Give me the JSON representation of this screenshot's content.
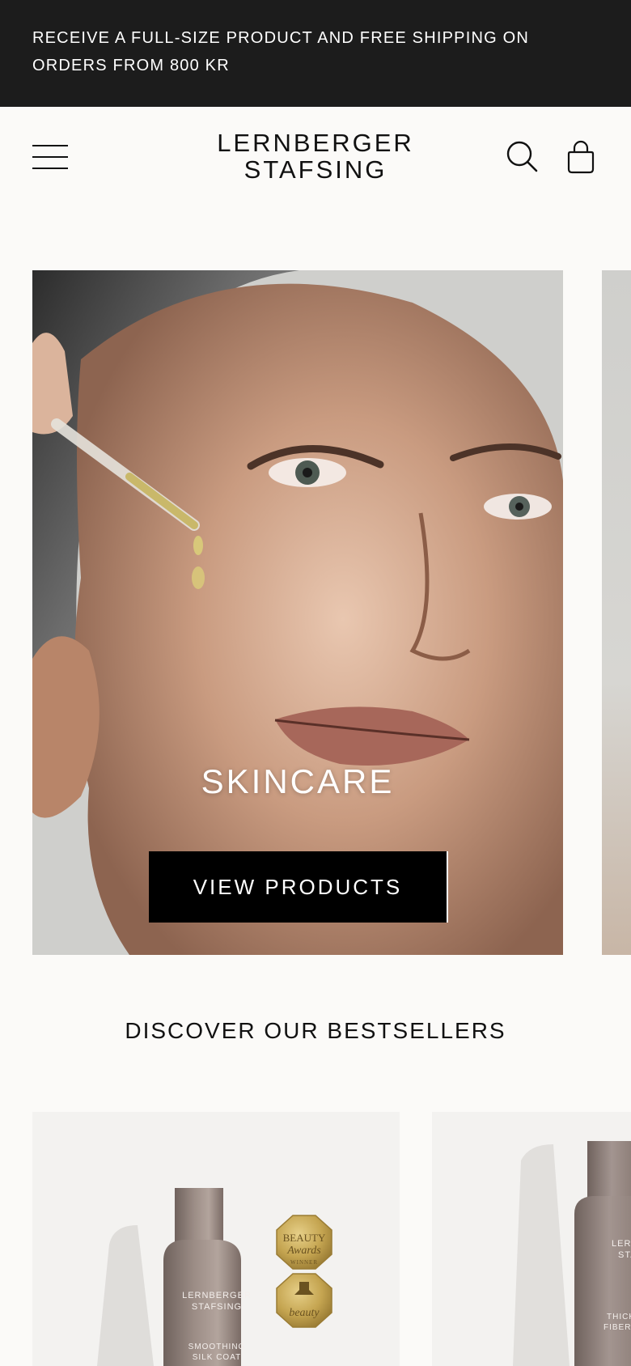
{
  "announcement": {
    "line1": "RECEIVE A FULL-SIZE PRODUCT AND FREE SHIPPING ON",
    "line2": "ORDERS FROM 800 KR"
  },
  "header": {
    "logo_line1": "LERNBERGER",
    "logo_line2": "STAFSING",
    "menu_icon": "hamburger-menu-icon",
    "search_icon": "search-icon",
    "cart_icon": "shopping-bag-icon"
  },
  "hero": {
    "slide_title": "SKINCARE",
    "cta_label": "VIEW PRODUCTS"
  },
  "bestsellers": {
    "title": "DISCOVER OUR BESTSELLERS",
    "products": [
      {
        "brand_line1": "LERNBERGER",
        "brand_line2": "STAFSING",
        "name_line1": "SMOOTHING",
        "name_line2": "SILK COAT",
        "badge1_line1": "BEAUTY",
        "badge1_line2": "Awards",
        "badge1_line3": "WINNER",
        "badge2_text": "beauty"
      },
      {
        "brand_line1": "LERNBERGER",
        "brand_line2": "STAFSING",
        "name_line1": "THICKENING",
        "name_line2": "FIBER MOUSSE"
      }
    ]
  },
  "colors": {
    "announcement_bg": "#1c1c1c",
    "page_bg": "#fbfaf8",
    "cta_bg": "#000000",
    "bottle": "#8d7f79"
  }
}
